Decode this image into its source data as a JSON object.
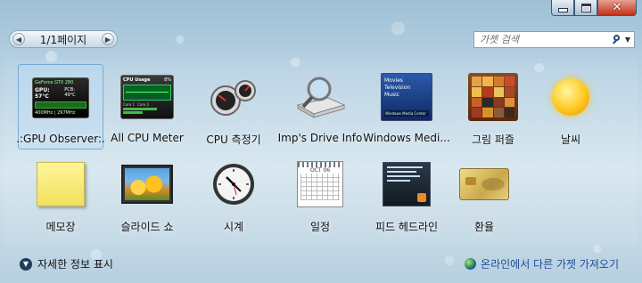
{
  "pager": {
    "text": "1/1페이지"
  },
  "search": {
    "placeholder": "가젯 검색",
    "icon": "search-icon"
  },
  "gadgets": [
    {
      "label": ".:GPU Observer:.",
      "icon": "gpu-observer-icon",
      "selected": true
    },
    {
      "label": "All CPU Meter",
      "icon": "cpu-meter-icon"
    },
    {
      "label": "CPU 측정기",
      "icon": "cpu-gauge-icon"
    },
    {
      "label": "Imp's Drive Info",
      "icon": "drive-info-icon"
    },
    {
      "label": "Windows Medi...",
      "icon": "media-center-icon"
    },
    {
      "label": "그림 퍼즐",
      "icon": "picture-puzzle-icon"
    },
    {
      "label": "날씨",
      "icon": "weather-sun-icon"
    },
    {
      "label": "메모장",
      "icon": "sticky-note-icon"
    },
    {
      "label": "슬라이드 쇼",
      "icon": "slideshow-icon"
    },
    {
      "label": "시계",
      "icon": "clock-icon"
    },
    {
      "label": "일정",
      "icon": "calendar-icon"
    },
    {
      "label": "피드 헤드라인",
      "icon": "feed-headlines-icon"
    },
    {
      "label": "환율",
      "icon": "currency-icon"
    }
  ],
  "thumb_text": {
    "gpu": {
      "title": "GeForce GTX 280",
      "temp": "GPU: 57°C",
      "pcb": "PCB: 49°C",
      "clock": "400MHz | 297MHz"
    },
    "cpu": {
      "title": "CPU Usage",
      "pct": "8%",
      "cores": [
        "Core 1",
        "Core 2"
      ]
    },
    "media": {
      "items": [
        "Movies",
        "Television",
        "Music"
      ],
      "brand": "Windows Media Center"
    },
    "calendar": {
      "month": "OCT 06"
    }
  },
  "footer": {
    "details_label": "자세한 정보 표시",
    "online_label": "온라인에서 다른 가젯 가져오기"
  },
  "colors": {
    "link": "#1d4f9c",
    "selection": "#bedcf5"
  }
}
